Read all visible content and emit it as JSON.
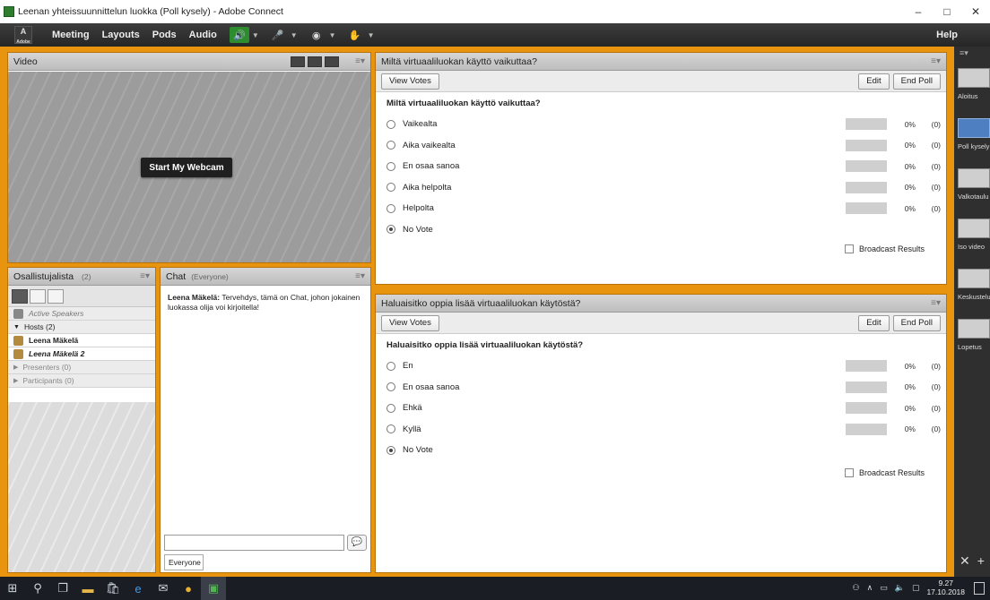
{
  "window": {
    "title": "Leenan yhteissuunnittelun luokka (Poll kysely) - Adobe Connect",
    "minimize": "–",
    "maximize": "□",
    "close": "✕"
  },
  "menubar": {
    "logo_text": "Adobe",
    "items": [
      "Meeting",
      "Layouts",
      "Pods",
      "Audio"
    ],
    "help": "Help"
  },
  "video_pod": {
    "title": "Video",
    "webcam_button": "Start My Webcam"
  },
  "attendees_pod": {
    "title": "Osallistujalista",
    "count": "(2)",
    "active_speakers": "Active Speakers",
    "hosts_label": "Hosts (2)",
    "hosts": [
      "Leena Mäkelä",
      "Leena Mäkelä 2"
    ],
    "presenters_label": "Presenters (0)",
    "participants_label": "Participants (0)"
  },
  "chat_pod": {
    "title": "Chat",
    "scope": "(Everyone)",
    "message_sender": "Leena Mäkelä:",
    "message_text": " Tervehdys, tämä on Chat, johon jokainen luokassa olija voi kirjoitella!",
    "input_value": "",
    "tab_label": "Everyone"
  },
  "poll1": {
    "title": "Miltä virtuaaliluokan käyttö vaikuttaa?",
    "view_votes": "View Votes",
    "edit": "Edit",
    "end_poll": "End Poll",
    "question": "Miltä virtuaaliluokan käyttö vaikuttaa?",
    "options": [
      {
        "label": "Vaikealta",
        "pct": "0%",
        "count": "(0)"
      },
      {
        "label": "Aika vaikealta",
        "pct": "0%",
        "count": "(0)"
      },
      {
        "label": "En osaa sanoa",
        "pct": "0%",
        "count": "(0)"
      },
      {
        "label": "Aika helpolta",
        "pct": "0%",
        "count": "(0)"
      },
      {
        "label": "Helpolta",
        "pct": "0%",
        "count": "(0)"
      }
    ],
    "no_vote": "No Vote",
    "broadcast": "Broadcast Results"
  },
  "poll2": {
    "title": "Haluaisitko oppia lisää virtuaaliluokan käytöstä?",
    "view_votes": "View Votes",
    "edit": "Edit",
    "end_poll": "End Poll",
    "question": "Haluaisitko oppia lisää virtuaaliluokan käytöstä?",
    "options": [
      {
        "label": "En",
        "pct": "0%",
        "count": "(0)"
      },
      {
        "label": "En osaa sanoa",
        "pct": "0%",
        "count": "(0)"
      },
      {
        "label": "Ehkä",
        "pct": "0%",
        "count": "(0)"
      },
      {
        "label": "Kyllä",
        "pct": "0%",
        "count": "(0)"
      }
    ],
    "no_vote": "No Vote",
    "broadcast": "Broadcast Results"
  },
  "layout_rail": {
    "items": [
      "Aloitus",
      "Poll kysely",
      "Valkotaulu",
      "Iso video",
      "Keskustelu",
      "Lopetus"
    ],
    "selected": "Poll kysely"
  },
  "taskbar": {
    "time": "9.27",
    "date": "17.10.2018"
  },
  "colors": {
    "stage_accent": "#e8940f",
    "menubar_bg": "#2b2b2b",
    "selected_layout": "#4d7fc1"
  }
}
